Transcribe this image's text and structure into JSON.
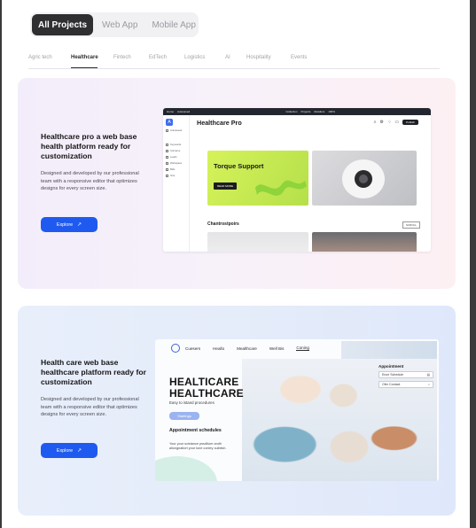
{
  "filters": [
    "All Projects",
    "Web App",
    "Mobile App"
  ],
  "categories": [
    "Agric tech",
    "Healthcare",
    "Fintech",
    "EdTech",
    "Logistics",
    "AI",
    "Hospitality",
    "Events"
  ],
  "colors": {
    "accent": "#1f5af0",
    "active_filter": "#2f2f31"
  },
  "projects": [
    {
      "title": "Healthcare pro a web base health platform ready for customization",
      "description": "Designed and developed by our professional team with a responsive editor that optimizes designs for every screen size.",
      "cta": "Explore",
      "cta_icon": "arrow-up-right-icon",
      "preview": {
        "topbar_left": [
          "Home",
          "Autosaved"
        ],
        "topbar_right": [
          "Collection",
          "Projects",
          "Retailers",
          "100%"
        ],
        "sidebar": [
          "Autosaved",
          "Keywords",
          "Surname",
          "Leads",
          "Webspace",
          "Bids",
          "Grip"
        ],
        "title": "Healthcare Pro",
        "publish": "Publish",
        "hero_title": "Torque Support",
        "hero_button": "READ MORE",
        "section_title": "Chantrostpoirs",
        "section_button": "SCROLL"
      }
    },
    {
      "title": "Health care web base healthcare platform ready for customization",
      "description": "Designed and developed by our professional team with a responsive editor that optimizes designs for every screen size.",
      "cta": "Explore",
      "cta_icon": "arrow-up-right-icon",
      "preview": {
        "nav": [
          "Cuesers",
          "Heallo",
          "Mealthcare",
          "Well Bis",
          "Coning"
        ],
        "headline": [
          "HEALTICARE",
          "HEALTHCARE"
        ],
        "tagline": "Easy to istand procedures",
        "pill": "Startings",
        "section_title": "Appointment schedules",
        "section_text": "Your your scistance pssdtiuer andh aliongnatiort your lune conley ouibiish.",
        "panel_title": "Appointment",
        "panel_fields": [
          "Ence Schedule",
          "Ofer Contact"
        ]
      }
    }
  ]
}
